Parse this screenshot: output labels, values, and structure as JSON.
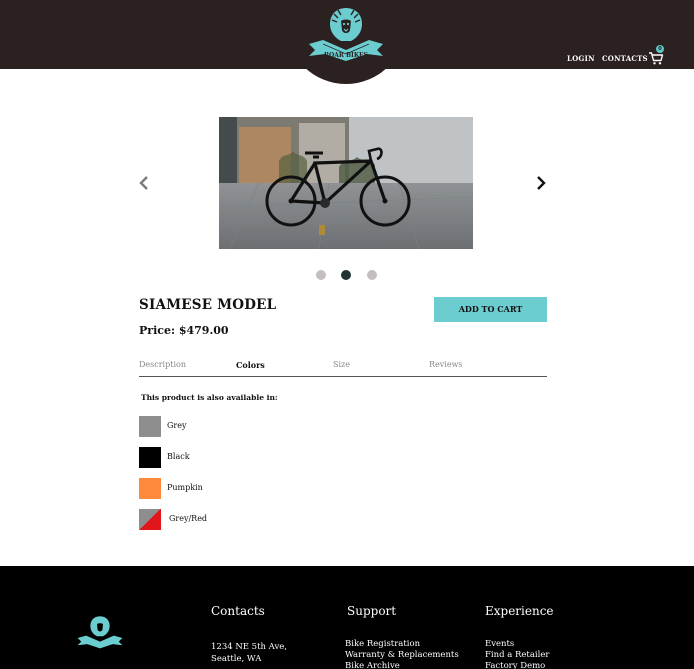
{
  "brand": {
    "logo_text": "ROAR BIKES",
    "accent_color": "#6ccdd0",
    "header_color": "#2a2120"
  },
  "nav": {
    "login": "LOGIN",
    "contacts": "CONTACTS",
    "cart_icon": "cart-icon",
    "cart_count": "0"
  },
  "carousel": {
    "prev_icon": "chevron-left-icon",
    "next_icon": "chevron-right-icon",
    "slide_count": 3,
    "active_index": 1
  },
  "product": {
    "name": "SIAMESE MODEL",
    "price": "Price: $479.00",
    "add_to_cart": "ADD TO CART"
  },
  "tabs": [
    {
      "label": "Description",
      "active": false
    },
    {
      "label": "Colors",
      "active": true
    },
    {
      "label": "Size",
      "active": false
    },
    {
      "label": "Reviews",
      "active": false
    }
  ],
  "colors": {
    "heading": "This product is also available in:",
    "options": [
      {
        "label": "Grey",
        "color": "#8e8e8e"
      },
      {
        "label": "Black",
        "color": "#000000"
      },
      {
        "label": "Pumpkin",
        "color": "#ff8a3d"
      },
      {
        "label": "Grey/Red",
        "color": "#8e8e8e",
        "color2": "#e0161b"
      }
    ]
  },
  "footer": {
    "contacts": {
      "title": "Contacts",
      "lines": [
        "1234 NE 5th Ave,",
        "Seattle, WA"
      ]
    },
    "support": {
      "title": "Support",
      "links": [
        "Bike Registration",
        "Warranty & Replacements",
        "Bike Archive"
      ]
    },
    "experience": {
      "title": "Experience",
      "links": [
        "Events",
        "Find a Retailer",
        "Factory Demo"
      ]
    }
  }
}
